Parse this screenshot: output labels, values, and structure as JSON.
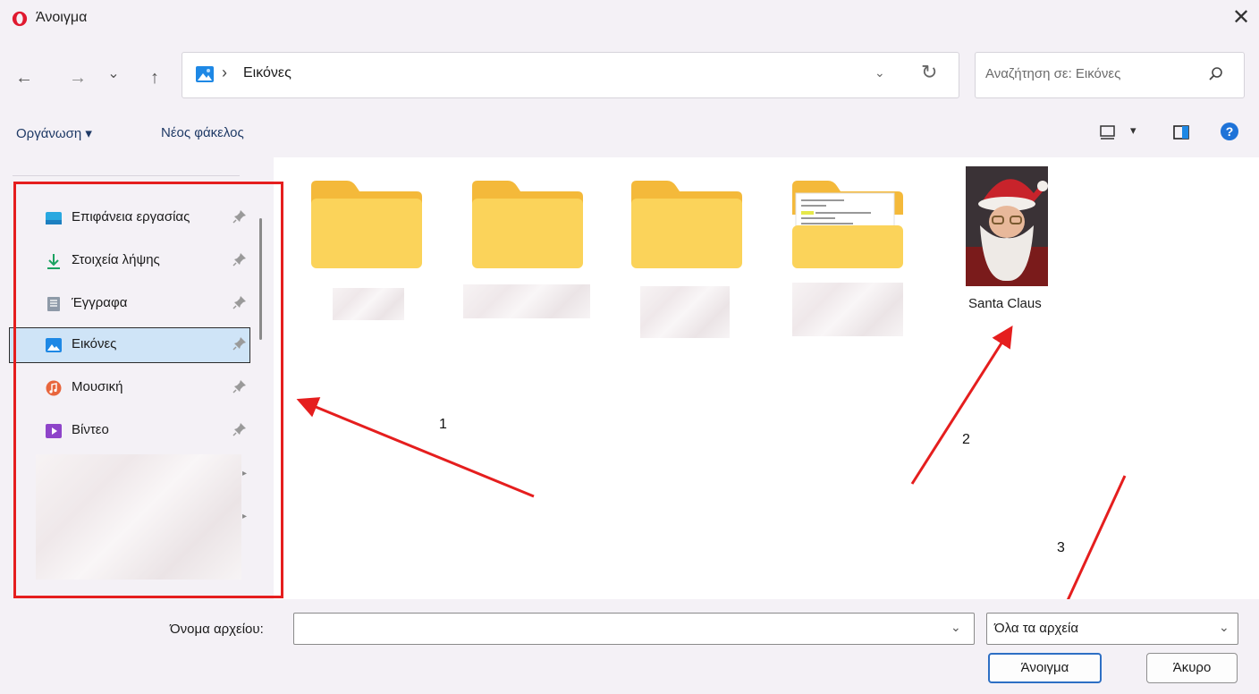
{
  "window": {
    "title": "Άνοιγμα",
    "close_glyph": "✕"
  },
  "nav": {
    "back": "←",
    "forward": "→",
    "recent": "⌄",
    "up": "↑"
  },
  "address": {
    "separator": "›",
    "location": "Εικόνες",
    "dropdown": "⌄",
    "refresh": "↻"
  },
  "search": {
    "placeholder": "Αναζήτηση σε: Εικόνες"
  },
  "toolbar": {
    "organize_label": "Οργάνωση ▾",
    "new_folder_label": "Νέος φάκελος",
    "view_caret": "▾",
    "help_glyph": "?"
  },
  "sidebar": {
    "items": [
      {
        "label": "Επιφάνεια εργασίας",
        "icon": "desktop-icon"
      },
      {
        "label": "Στοιχεία λήψης",
        "icon": "download-icon"
      },
      {
        "label": "Έγγραφα",
        "icon": "documents-icon"
      },
      {
        "label": "Εικόνες",
        "icon": "pictures-icon",
        "selected": true
      },
      {
        "label": "Μουσική",
        "icon": "music-icon"
      },
      {
        "label": "Βίντεο",
        "icon": "video-icon"
      }
    ],
    "expand_arrow": "▸"
  },
  "files": {
    "santa_label": "Santa Claus"
  },
  "annotations": {
    "one": "1",
    "two": "2",
    "three": "3"
  },
  "bottom": {
    "filename_label": "Όνομα αρχείου:",
    "filename_value": "",
    "dropdown": "⌄",
    "filetype_value": "Όλα τα αρχεία",
    "open_label": "Άνοιγμα",
    "cancel_label": "Άκυρο"
  },
  "colors": {
    "annotation_red": "#e51e1e",
    "selected_bg": "#cfe4f7",
    "folder_yellow": "#f7c948"
  }
}
